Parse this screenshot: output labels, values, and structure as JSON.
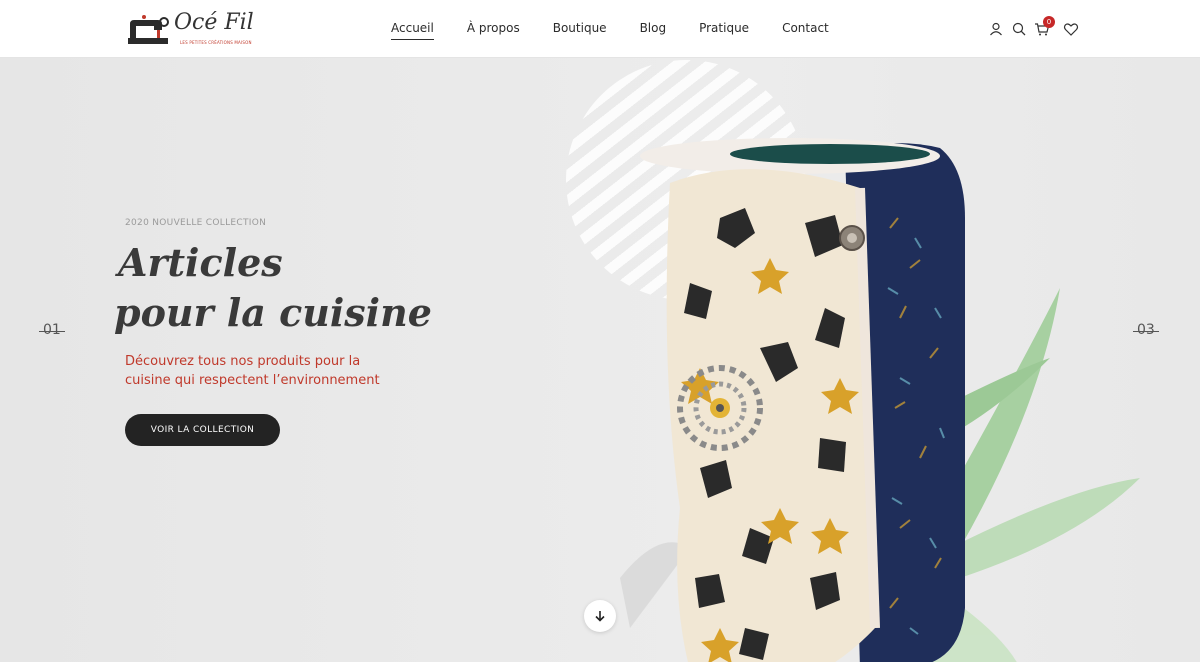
{
  "brand": {
    "wordmark": "Océ Fil",
    "tagline": "LES PETITES CRÉATIONS MAISON"
  },
  "nav": {
    "items": [
      {
        "label": "Accueil",
        "active": true
      },
      {
        "label": "À propos",
        "active": false
      },
      {
        "label": "Boutique",
        "active": false
      },
      {
        "label": "Blog",
        "active": false
      },
      {
        "label": "Pratique",
        "active": false
      },
      {
        "label": "Contact",
        "active": false
      }
    ]
  },
  "header_icons": {
    "account": "user-icon",
    "search": "search-icon",
    "cart": "cart-icon",
    "cart_count": "0",
    "wishlist": "heart-icon"
  },
  "hero": {
    "eyebrow": "2020 NOUVELLE COLLECTION",
    "title_line1": "Articles",
    "title_line2": "pour la cuisine",
    "subtitle": "Découvrez tous nos produits pour la cuisine qui respectent l’environnement",
    "cta_label": "VOIR LA COLLECTION",
    "slide_prev": "01",
    "slide_next": "03",
    "scroll_icon": "arrow-down-icon"
  },
  "colors": {
    "accent_red": "#c0392b",
    "cta_bg": "#232323",
    "badge": "#c62828"
  }
}
